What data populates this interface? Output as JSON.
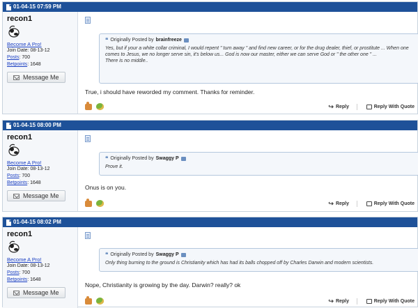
{
  "posts": [
    {
      "timestamp": "01-04-15 07:59 PM",
      "user": {
        "name": "recon1",
        "pro_link": "Become A Pro!",
        "join_label": "Join Date:",
        "join_date": "08-13-12",
        "posts_label": "Posts",
        "posts": "700",
        "betpoints_label": "Betpoints",
        "betpoints": "1648",
        "message_btn": "Message Me"
      },
      "quote": {
        "prefix": "Originally Posted by",
        "author": "brainfreeze",
        "text": "Yes, but if your a white collar criminal, I would repent \" turn away \" and find new career, or for the drug dealer, thief, or prostitute ... When one comes to Jesus, we no longer serve sin, it's below us... God is now our master, either we can serve God or \" the other one \" ...\nThere is no middle.."
      },
      "reply": "True, i should have reworded my comment. Thanks for reminder.",
      "actions": {
        "reply": "Reply",
        "reply_with_quote": "Reply With Quote"
      }
    },
    {
      "timestamp": "01-04-15 08:00 PM",
      "user": {
        "name": "recon1",
        "pro_link": "Become A Pro!",
        "join_label": "Join Date:",
        "join_date": "08-13-12",
        "posts_label": "Posts",
        "posts": "700",
        "betpoints_label": "Betpoints",
        "betpoints": "1648",
        "message_btn": "Message Me"
      },
      "quote": {
        "prefix": "Originally Posted by",
        "author": "Swaggy P",
        "text": "Prove it."
      },
      "reply": "Onus is on you.",
      "actions": {
        "reply": "Reply",
        "reply_with_quote": "Reply With Quote"
      }
    },
    {
      "timestamp": "01-04-15 08:02 PM",
      "user": {
        "name": "recon1",
        "pro_link": "Become A Pro!",
        "join_label": "Join Date:",
        "join_date": "08-13-12",
        "posts_label": "Posts",
        "posts": "700",
        "betpoints_label": "Betpoints",
        "betpoints": "1648",
        "message_btn": "Message Me"
      },
      "quote": {
        "prefix": "Originally Posted by",
        "author": "Swaggy P",
        "text": "Only thing burning to the ground is Christianity which has had its balls chopped off by Charles Darwin and modern scientists."
      },
      "reply": "Nope, Christianity is growing by the day. Darwin? really? ok",
      "actions": {
        "reply": "Reply",
        "reply_with_quote": "Reply With Quote"
      }
    }
  ],
  "colors": {
    "header_bg": "#1e5199",
    "link": "#1a3fc2",
    "quote_bg": "#f4f7fb",
    "quote_border": "#b4c7dd"
  },
  "icons": [
    "post-icon",
    "quote-icon",
    "view-post-icon",
    "thumbs-up-icon",
    "troll-icon",
    "reply-arrow-icon",
    "reply-with-quote-icon",
    "envelope-icon",
    "avatar-icon"
  ]
}
